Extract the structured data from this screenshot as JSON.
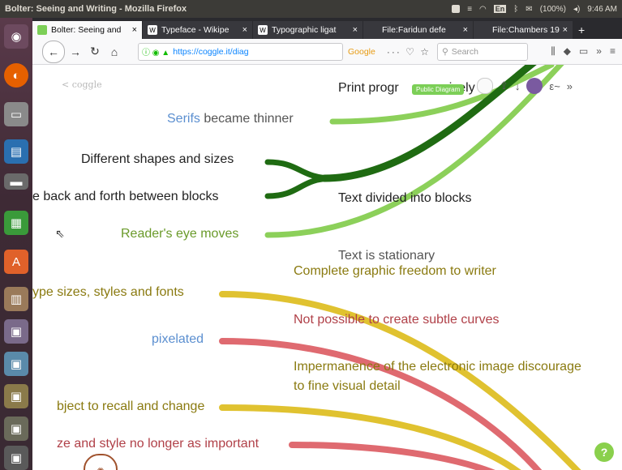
{
  "window": {
    "title": "Bolter: Seeing and Writing - Mozilla Firefox"
  },
  "tray": {
    "lang": "En",
    "battery": "(100%)",
    "clock": "9:46 AM"
  },
  "tabs": [
    {
      "label": "Bolter: Seeing and",
      "favicon": "coggle-icon",
      "active": true
    },
    {
      "label": "Typeface - Wikipe",
      "favicon": "W",
      "active": false
    },
    {
      "label": "Typographic ligat",
      "favicon": "W",
      "active": false
    },
    {
      "label": "File:Faridun defe",
      "favicon": "",
      "active": false
    },
    {
      "label": "File:Chambers 19",
      "favicon": "",
      "active": false
    }
  ],
  "nav": {
    "url": "https://coggle.it/diag",
    "search_engine": "Google",
    "search_placeholder": "Search"
  },
  "coggle": {
    "logo": "< coggle",
    "badge": "Public Diagram",
    "help": "?"
  },
  "nodes": {
    "print": "Print progr",
    "print_tail": "ively",
    "serifs_word": "Serifs",
    "serifs_rest": " became thinner",
    "shapes": "Different shapes and sizes",
    "blocks_move": "e back and forth between blocks",
    "text_blocks": "Text divided into blocks",
    "eye_moves": "Reader's eye moves",
    "stationary": "Text is stationary",
    "freedom": "Complete graphic freedom to writer",
    "type_sizes": "ype sizes, styles and fonts",
    "subtle": "Not possible to create subtle curves",
    "pixelated": "pixelated",
    "impermanence_1": "Impermanence of the electronic image discourage",
    "impermanence_2": "to fine visual detail",
    "recall": "bject to recall and change",
    "style": "ze and style no longer as important"
  }
}
